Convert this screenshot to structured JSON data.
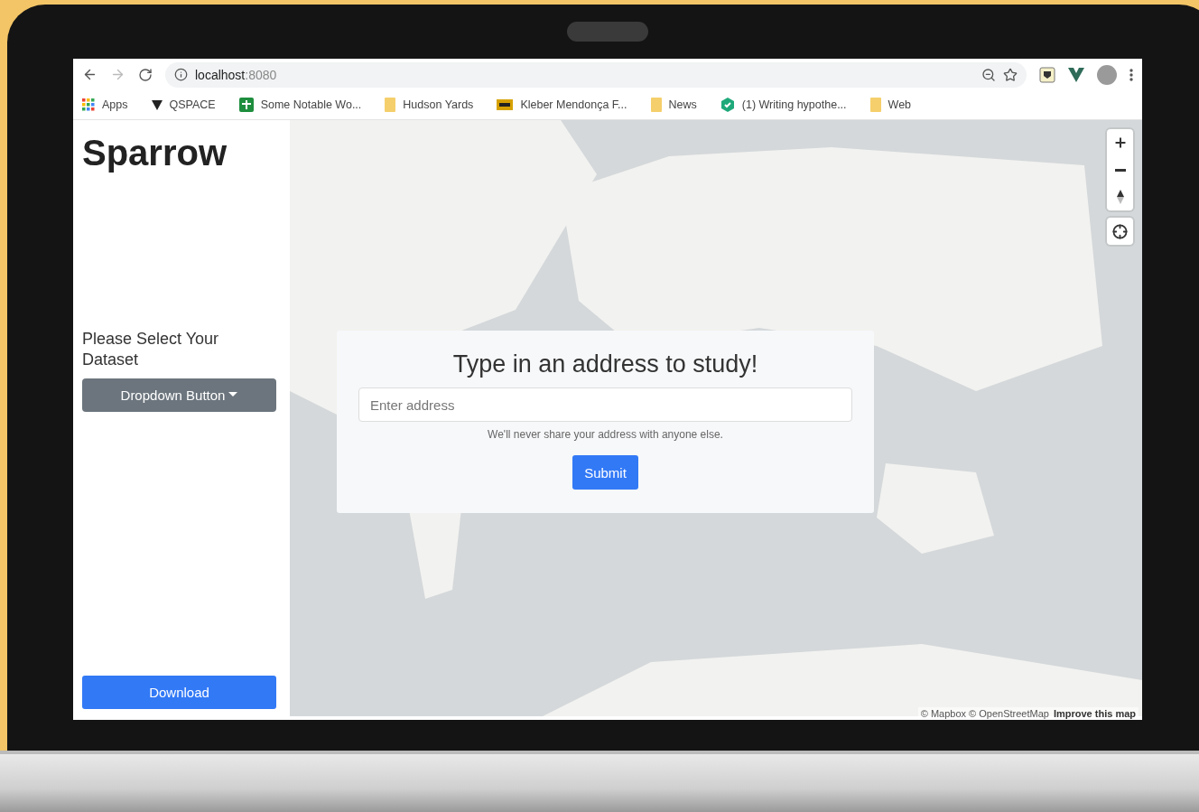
{
  "browser": {
    "url": {
      "host": "localhost",
      "port": ":8080"
    },
    "bookmarks": [
      {
        "label": "Apps",
        "kind": "apps"
      },
      {
        "label": "QSPACE",
        "kind": "vee"
      },
      {
        "label": "Some Notable Wo...",
        "kind": "sheet"
      },
      {
        "label": "Hudson Yards",
        "kind": "folder"
      },
      {
        "label": "Kleber Mendonça F...",
        "kind": "imdb"
      },
      {
        "label": "News",
        "kind": "folder"
      },
      {
        "label": "(1) Writing hypothe...",
        "kind": "hex"
      },
      {
        "label": "Web",
        "kind": "folder"
      }
    ]
  },
  "sidebar": {
    "title": "Sparrow",
    "prompt": "Please Select Your Dataset",
    "dropdown": "Dropdown Button",
    "download": "Download"
  },
  "form": {
    "heading": "Type in an address to study!",
    "placeholder": "Enter address",
    "help": "We'll never share your address with anyone else.",
    "submit": "Submit"
  },
  "map": {
    "attribution": "© Mapbox © OpenStreetMap",
    "improve_link": "Improve this map"
  }
}
